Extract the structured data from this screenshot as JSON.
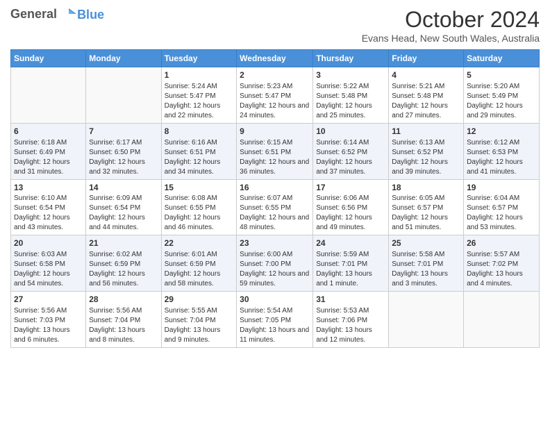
{
  "header": {
    "logo_line1": "General",
    "logo_line2": "Blue",
    "month": "October 2024",
    "location": "Evans Head, New South Wales, Australia"
  },
  "days_of_week": [
    "Sunday",
    "Monday",
    "Tuesday",
    "Wednesday",
    "Thursday",
    "Friday",
    "Saturday"
  ],
  "weeks": [
    [
      {
        "day": "",
        "info": ""
      },
      {
        "day": "",
        "info": ""
      },
      {
        "day": "1",
        "info": "Sunrise: 5:24 AM\nSunset: 5:47 PM\nDaylight: 12 hours and 22 minutes."
      },
      {
        "day": "2",
        "info": "Sunrise: 5:23 AM\nSunset: 5:47 PM\nDaylight: 12 hours and 24 minutes."
      },
      {
        "day": "3",
        "info": "Sunrise: 5:22 AM\nSunset: 5:48 PM\nDaylight: 12 hours and 25 minutes."
      },
      {
        "day": "4",
        "info": "Sunrise: 5:21 AM\nSunset: 5:48 PM\nDaylight: 12 hours and 27 minutes."
      },
      {
        "day": "5",
        "info": "Sunrise: 5:20 AM\nSunset: 5:49 PM\nDaylight: 12 hours and 29 minutes."
      }
    ],
    [
      {
        "day": "6",
        "info": "Sunrise: 6:18 AM\nSunset: 6:49 PM\nDaylight: 12 hours and 31 minutes."
      },
      {
        "day": "7",
        "info": "Sunrise: 6:17 AM\nSunset: 6:50 PM\nDaylight: 12 hours and 32 minutes."
      },
      {
        "day": "8",
        "info": "Sunrise: 6:16 AM\nSunset: 6:51 PM\nDaylight: 12 hours and 34 minutes."
      },
      {
        "day": "9",
        "info": "Sunrise: 6:15 AM\nSunset: 6:51 PM\nDaylight: 12 hours and 36 minutes."
      },
      {
        "day": "10",
        "info": "Sunrise: 6:14 AM\nSunset: 6:52 PM\nDaylight: 12 hours and 37 minutes."
      },
      {
        "day": "11",
        "info": "Sunrise: 6:13 AM\nSunset: 6:52 PM\nDaylight: 12 hours and 39 minutes."
      },
      {
        "day": "12",
        "info": "Sunrise: 6:12 AM\nSunset: 6:53 PM\nDaylight: 12 hours and 41 minutes."
      }
    ],
    [
      {
        "day": "13",
        "info": "Sunrise: 6:10 AM\nSunset: 6:54 PM\nDaylight: 12 hours and 43 minutes."
      },
      {
        "day": "14",
        "info": "Sunrise: 6:09 AM\nSunset: 6:54 PM\nDaylight: 12 hours and 44 minutes."
      },
      {
        "day": "15",
        "info": "Sunrise: 6:08 AM\nSunset: 6:55 PM\nDaylight: 12 hours and 46 minutes."
      },
      {
        "day": "16",
        "info": "Sunrise: 6:07 AM\nSunset: 6:55 PM\nDaylight: 12 hours and 48 minutes."
      },
      {
        "day": "17",
        "info": "Sunrise: 6:06 AM\nSunset: 6:56 PM\nDaylight: 12 hours and 49 minutes."
      },
      {
        "day": "18",
        "info": "Sunrise: 6:05 AM\nSunset: 6:57 PM\nDaylight: 12 hours and 51 minutes."
      },
      {
        "day": "19",
        "info": "Sunrise: 6:04 AM\nSunset: 6:57 PM\nDaylight: 12 hours and 53 minutes."
      }
    ],
    [
      {
        "day": "20",
        "info": "Sunrise: 6:03 AM\nSunset: 6:58 PM\nDaylight: 12 hours and 54 minutes."
      },
      {
        "day": "21",
        "info": "Sunrise: 6:02 AM\nSunset: 6:59 PM\nDaylight: 12 hours and 56 minutes."
      },
      {
        "day": "22",
        "info": "Sunrise: 6:01 AM\nSunset: 6:59 PM\nDaylight: 12 hours and 58 minutes."
      },
      {
        "day": "23",
        "info": "Sunrise: 6:00 AM\nSunset: 7:00 PM\nDaylight: 12 hours and 59 minutes."
      },
      {
        "day": "24",
        "info": "Sunrise: 5:59 AM\nSunset: 7:01 PM\nDaylight: 13 hours and 1 minute."
      },
      {
        "day": "25",
        "info": "Sunrise: 5:58 AM\nSunset: 7:01 PM\nDaylight: 13 hours and 3 minutes."
      },
      {
        "day": "26",
        "info": "Sunrise: 5:57 AM\nSunset: 7:02 PM\nDaylight: 13 hours and 4 minutes."
      }
    ],
    [
      {
        "day": "27",
        "info": "Sunrise: 5:56 AM\nSunset: 7:03 PM\nDaylight: 13 hours and 6 minutes."
      },
      {
        "day": "28",
        "info": "Sunrise: 5:56 AM\nSunset: 7:04 PM\nDaylight: 13 hours and 8 minutes."
      },
      {
        "day": "29",
        "info": "Sunrise: 5:55 AM\nSunset: 7:04 PM\nDaylight: 13 hours and 9 minutes."
      },
      {
        "day": "30",
        "info": "Sunrise: 5:54 AM\nSunset: 7:05 PM\nDaylight: 13 hours and 11 minutes."
      },
      {
        "day": "31",
        "info": "Sunrise: 5:53 AM\nSunset: 7:06 PM\nDaylight: 13 hours and 12 minutes."
      },
      {
        "day": "",
        "info": ""
      },
      {
        "day": "",
        "info": ""
      }
    ]
  ]
}
